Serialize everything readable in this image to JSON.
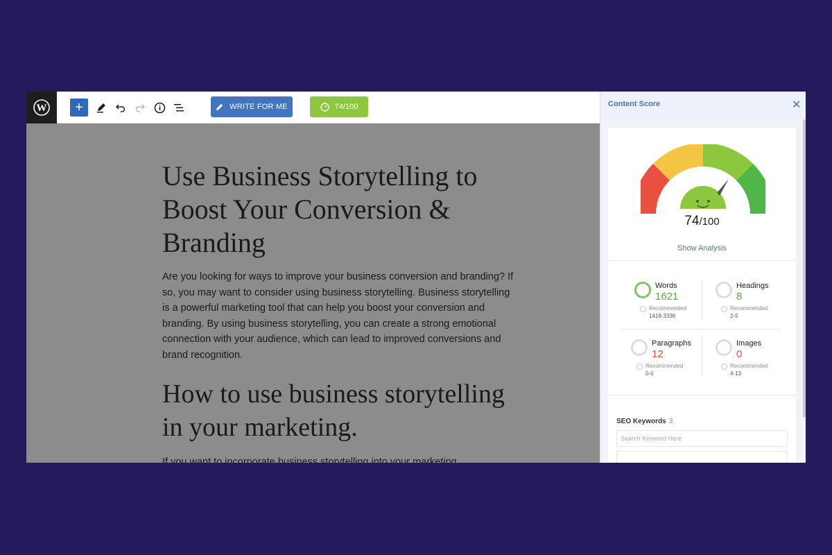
{
  "toolbar": {
    "write_label": "WRITE FOR ME",
    "score_label": "74/100"
  },
  "post": {
    "title": "Use Business Storytelling to Boost Your Conversion & Branding",
    "paragraph": "Are you looking for ways to improve your business conversion and branding? If so, you may want to consider using business storytelling. Business storytelling is a powerful marketing tool that can help you boost your conversion and branding. By using business storytelling, you can create a strong emotional connection with your audience, which can lead to improved conversions and brand recognition.",
    "heading2": "How to use business storytelling in your marketing.",
    "next_paragraph": "If you want to incorporate business storytelling into your marketing"
  },
  "sidebar": {
    "title": "Content Score",
    "score_value": "74",
    "score_max": "/100",
    "score_fraction": 0.74,
    "show_analysis": "Show Analysis",
    "stats": [
      {
        "label": "Words",
        "value": "1621",
        "rec_label": "Recommended",
        "range": "1418-3336",
        "status": "good"
      },
      {
        "label": "Headings",
        "value": "8",
        "rec_label": "Recommended",
        "range": "2-5",
        "status": "good"
      },
      {
        "label": "Paragraphs",
        "value": "12",
        "rec_label": "Recommended",
        "range": "0-0",
        "status": "bad"
      },
      {
        "label": "Images",
        "value": "0",
        "rec_label": "Recommended",
        "range": "4-13",
        "status": "bad"
      }
    ],
    "seo_keywords_label": "SEO Keywords",
    "seo_keywords_count": "3",
    "seo_placeholder": "Search Keyword Here"
  },
  "colors": {
    "background": "#251a5c",
    "primary_blue": "#4275c0",
    "score_green": "#8dc63f",
    "gauge_red": "#e8513f",
    "gauge_yellow": "#f4c542",
    "gauge_light_green": "#8dc63f",
    "gauge_green": "#4fb648"
  },
  "icons": {
    "logo": "wordpress-logo",
    "add": "plus-icon",
    "tools": "pencil-icon",
    "undo": "undo-icon",
    "redo": "redo-icon",
    "info": "info-icon",
    "outline": "list-view-icon",
    "write": "pencil-icon",
    "score": "gauge-icon",
    "close": "close-icon"
  }
}
